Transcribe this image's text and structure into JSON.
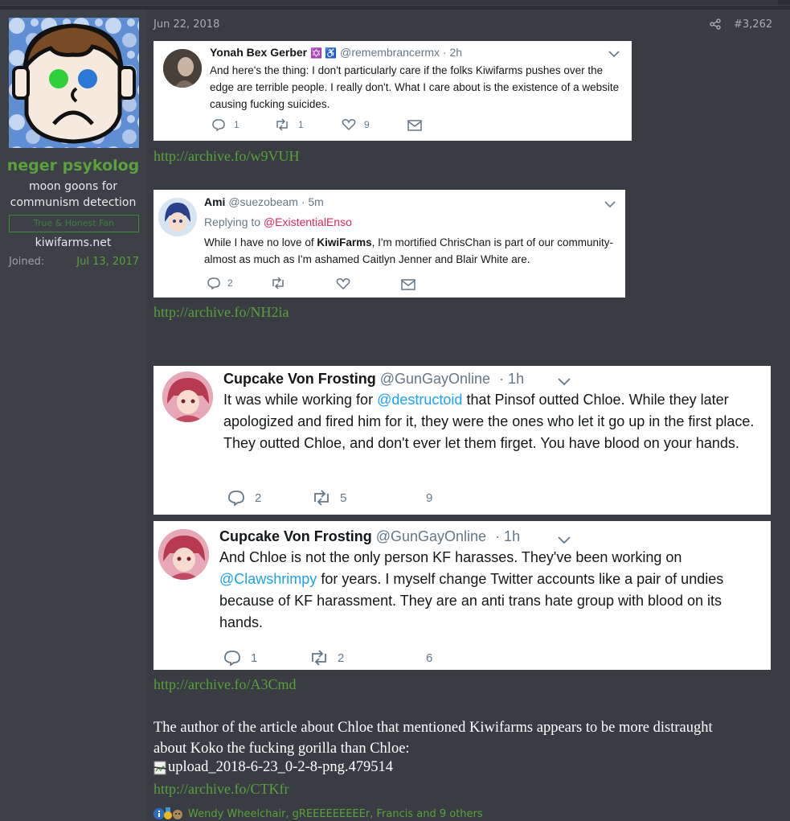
{
  "post": {
    "date": "Jun 22, 2018",
    "number": "#3,262"
  },
  "user": {
    "name": "neger psykolog",
    "title": "moon goons for communism detection",
    "banner": "True & Honest Fan",
    "site": "kiwifarms.net",
    "joined_label": "Joined:",
    "joined_date": "Jul 13, 2017"
  },
  "tweets": [
    {
      "name": "Yonah Bex Gerber",
      "emoji": "✡️ ♿",
      "handle": "@remembrancermx",
      "time": "· 2h",
      "text": "And here's the thing: I don't particularly care if the folks Kiwifarms pushes over the edge are terrible people. I really don't. What I care about is the existence of a website causing fucking suicides.",
      "replies": "1",
      "retweets": "1",
      "likes": "9"
    },
    {
      "name": "Ami",
      "handle": "@suezobeam",
      "time": "· 5m",
      "replying_label": "Replying to",
      "replying_to": "@ExistentialEnso",
      "text_pre": "While I have no love of",
      "text_bold": "KiwiFarms",
      "text_post": ", I'm mortified ChrisChan is part of our community- almost as much as I'm ashamed Caitlyn Jenner and Blair White are.",
      "replies": "2"
    },
    {
      "name": "Cupcake Von Frosting",
      "handle": "@GunGayOnline",
      "time": "· 1h",
      "text_pre": "It was while working for",
      "mention": "@destructoid",
      "text_post": "that Pinsof outted Chloe. While they later apologized and fired him for it, they were the ones who let it go up in the first place. They outted Chloe, and don't ever let them firget. You have blood on your hands.",
      "replies": "2",
      "retweets": "5",
      "likes": "9"
    },
    {
      "name": "Cupcake Von Frosting",
      "handle": "@GunGayOnline",
      "time": "· 1h",
      "text_pre": "And Chloe is not the only person KF harasses. They've been working on",
      "mention": "@Clawshrimpy",
      "text_post": "for years. I myself change Twitter accounts like a pair of undies because of KF harassment. They are an anti trans hate group with blood on its hands.",
      "replies": "1",
      "retweets": "2",
      "likes": "6"
    }
  ],
  "links": {
    "first": "http://archive.fo/w9VUH",
    "second": "http://archive.fo/NH2ia",
    "third": "http://archive.fo/A3Cmd",
    "fourth": "http://archive.fo/CTKfr"
  },
  "body": {
    "paragraph": "The author of the article about Chloe that mentioned Kiwifarms appears to be more distraught about Koko the fucking gorilla than Chloe:",
    "image_alt": "upload_2018-6-23_0-2-8-png.479514"
  },
  "reactions": {
    "text": "Wendy Wheelchair, gREEEEEEEEEr, Francis and 9 others"
  },
  "icons": [
    "share-icon",
    "reply-icon",
    "retweet-icon",
    "heart-icon",
    "mail-icon",
    "chevron-down-icon",
    "broken-image-icon",
    "info-icon",
    "medal-icon",
    "reaction-icon"
  ],
  "colors": {
    "accent_green": "#5aa03c",
    "twitter_blue": "#1da1f2",
    "twitter_grey": "#657786"
  }
}
